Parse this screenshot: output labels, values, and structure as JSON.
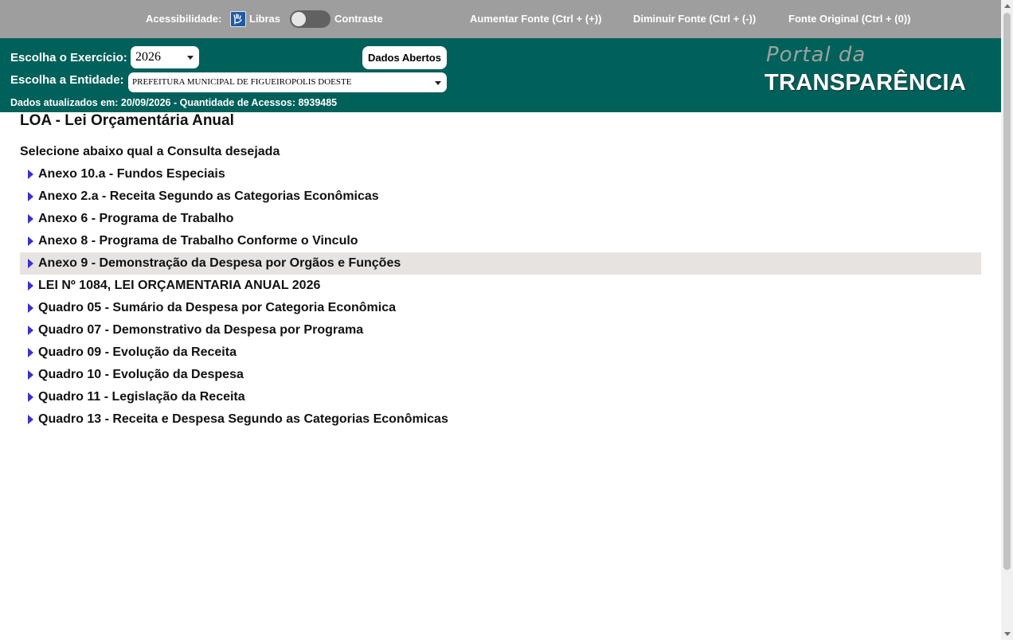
{
  "accessibility": {
    "label": "Acessibilidade:",
    "libras": "Libras",
    "contrast": "Contraste",
    "font_increase": "Aumentar Fonte (Ctrl + (+))",
    "font_decrease": "Diminuir Fonte (Ctrl + (-))",
    "font_original": "Fonte Original (Ctrl + (0))"
  },
  "header": {
    "year_label": "Escolha o Exercício:",
    "year_value": "2026",
    "entity_label": "Escolha a Entidade:",
    "entity_value": "PREFEITURA MUNICIPAL DE FIGUEIROPOLIS DOESTE",
    "open_data_button": "Dados Abertos",
    "status": "Dados atualizados em: 20/09/2026 - Quantidade de Acessos: 8939485",
    "logo_line1": "Portal da",
    "logo_line2": "TRANSPARÊNCIA"
  },
  "main": {
    "title": "LOA - Lei Orçamentária Anual",
    "subtitle": "Selecione abaixo qual a Consulta desejada",
    "items": [
      "Anexo 10.a - Fundos Especiais",
      "Anexo 2.a - Receita Segundo as Categorias Econômicas",
      "Anexo 6 - Programa de Trabalho",
      "Anexo 8 - Programa de Trabalho Conforme o Vinculo",
      "Anexo 9 - Demonstração da Despesa por Orgãos e Funções",
      "LEI Nº 1084, LEI ORÇAMENTARIA ANUAL 2026",
      "Quadro 05 - Sumário da Despesa por Categoria Econômica",
      "Quadro 07 - Demonstrativo da Despesa por Programa",
      "Quadro 09 - Evolução da Receita",
      "Quadro 10 - Evolução da Despesa",
      "Quadro 11 - Legislação da Receita",
      "Quadro 13 - Receita e Despesa Segundo as Categorias Econômicas"
    ],
    "highlighted_index": 4
  },
  "colors": {
    "header_bg": "#00605a",
    "accessibility_bg": "#9e9e9e",
    "highlight_bg": "#e7e3e1",
    "arrow": "#3a2fd1"
  }
}
